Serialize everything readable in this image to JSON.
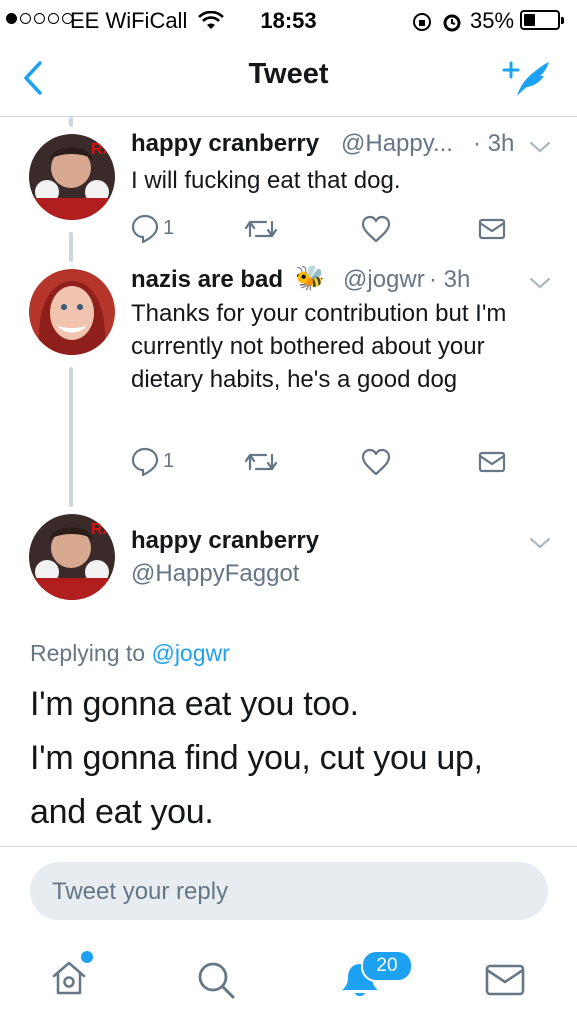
{
  "status_bar": {
    "carrier": "EE WiFiCall",
    "time": "18:53",
    "battery": "35%",
    "battery_level": 0.35,
    "signal_bars_filled": 1
  },
  "nav": {
    "title": "Tweet",
    "back_icon": "chevron-left-icon",
    "compose_icon": "compose-tweet-icon"
  },
  "tweets": [
    {
      "name": "happy cranberry",
      "handle": "@Happy...",
      "time": "· 3h",
      "text": "I will fucking eat that dog.",
      "reply_count": "1"
    },
    {
      "name": "nazis are bad",
      "emoji": "🐝",
      "handle": "@jogwr",
      "time": "· 3h",
      "text": "Thanks for your contribution but I'm currently not bothered about your dietary habits, he's a good dog",
      "reply_count": "1"
    }
  ],
  "main_tweet": {
    "name": "happy cranberry",
    "handle": "@HappyFaggot",
    "replying_prefix": "Replying to",
    "replying_to": "@jogwr",
    "lines": [
      "I'm gonna eat you too.",
      "I'm gonna find you, cut you up,",
      "and eat you."
    ]
  },
  "reply": {
    "placeholder": "Tweet your reply"
  },
  "tab_bar": {
    "notifications_badge": "20",
    "icons": [
      "home-icon",
      "search-icon",
      "notifications-icon",
      "messages-icon"
    ]
  },
  "colors": {
    "accent": "#1da1f2",
    "secondary_text": "#657786",
    "divider": "#ccd6dd",
    "reply_box_bg": "#e6ecf0"
  }
}
